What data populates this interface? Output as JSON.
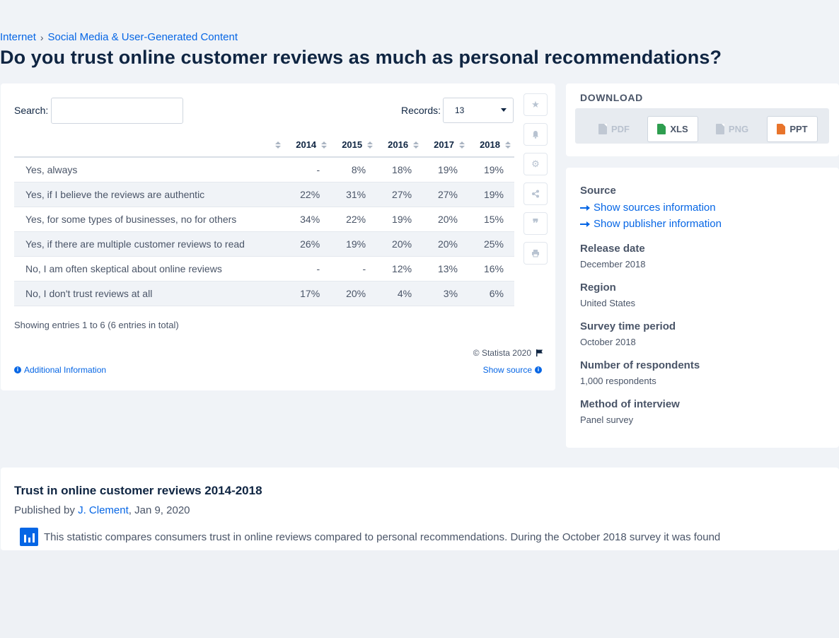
{
  "breadcrumb": {
    "root": "Internet",
    "separator": "›",
    "current": "Social Media & User-Generated Content"
  },
  "title": "Do you trust online customer reviews as much as personal recommendations?",
  "table_controls": {
    "search_label": "Search:",
    "search_value": "",
    "records_label": "Records:",
    "records_value": "13"
  },
  "table": {
    "headers": [
      "",
      "2014",
      "2015",
      "2016",
      "2017",
      "2018"
    ],
    "rows": [
      {
        "label": "Yes, always",
        "values": [
          "-",
          "8%",
          "18%",
          "19%",
          "19%"
        ]
      },
      {
        "label": "Yes, if I believe the reviews are authentic",
        "values": [
          "22%",
          "31%",
          "27%",
          "27%",
          "19%"
        ]
      },
      {
        "label": "Yes, for some types of businesses, no for others",
        "values": [
          "34%",
          "22%",
          "19%",
          "20%",
          "15%"
        ]
      },
      {
        "label": "Yes, if there are multiple customer reviews to read",
        "values": [
          "26%",
          "19%",
          "20%",
          "20%",
          "25%"
        ]
      },
      {
        "label": "No, I am often skeptical about online reviews",
        "values": [
          "-",
          "-",
          "12%",
          "13%",
          "16%"
        ]
      },
      {
        "label": "No, I don't trust reviews at all",
        "values": [
          "17%",
          "20%",
          "4%",
          "3%",
          "6%"
        ]
      }
    ]
  },
  "entries_text": "Showing entries 1 to 6 (6 entries in total)",
  "copyright": "© Statista 2020",
  "additional_info": "Additional Information",
  "show_source": "Show source",
  "tools": [
    "star-icon",
    "bell-icon",
    "gear-icon",
    "share-icon",
    "quote-icon",
    "print-icon"
  ],
  "download": {
    "title": "DOWNLOAD",
    "buttons": [
      {
        "label": "PDF",
        "enabled": false,
        "color": "#c0c8d3"
      },
      {
        "label": "XLS",
        "enabled": true,
        "color": "#2e9e4f"
      },
      {
        "label": "PNG",
        "enabled": false,
        "color": "#c0c8d3"
      },
      {
        "label": "PPT",
        "enabled": true,
        "color": "#e8742b"
      }
    ]
  },
  "source_panel": {
    "source_heading": "Source",
    "show_sources": "Show sources information",
    "show_publisher": "Show publisher information",
    "release_date_h": "Release date",
    "release_date": "December 2018",
    "region_h": "Region",
    "region": "United States",
    "survey_period_h": "Survey time period",
    "survey_period": "October 2018",
    "respondents_h": "Number of respondents",
    "respondents": "1,000 respondents",
    "method_h": "Method of interview",
    "method": "Panel survey"
  },
  "article": {
    "title": "Trust in online customer reviews 2014-2018",
    "published_prefix": "Published by",
    "author": "J. Clement",
    "date": ", Jan 9, 2020",
    "text": "This statistic compares consumers trust in online reviews compared to personal recommendations. During the October 2018 survey it was found"
  },
  "colors": {
    "accent": "#0666e5",
    "text": "#0f2542",
    "muted": "#4a5568",
    "background": "#f0f3f7"
  }
}
